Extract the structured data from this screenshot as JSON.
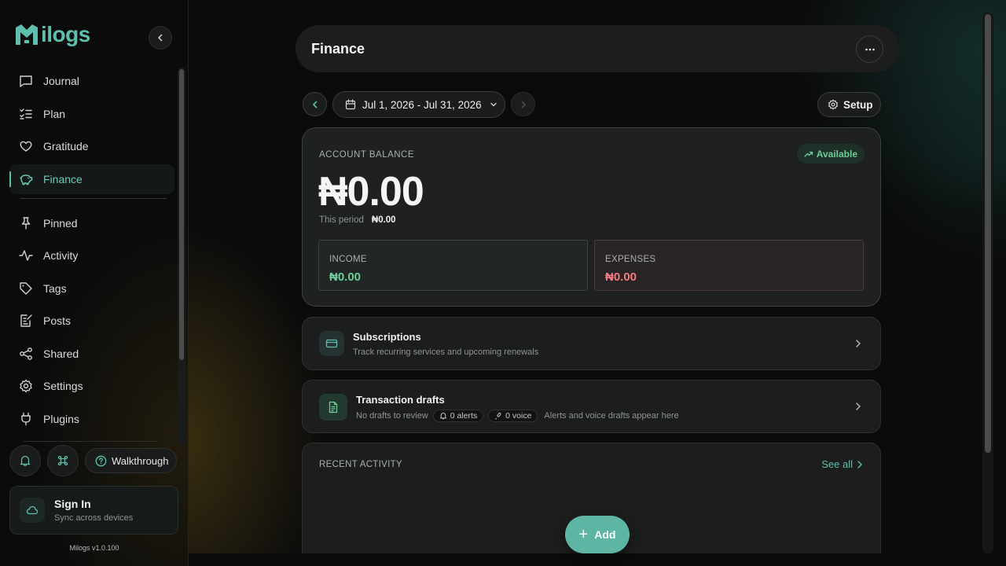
{
  "app": {
    "name": "Milogs",
    "version": "Milogs v1.0.100"
  },
  "colors": {
    "accent": "#5fbfae",
    "income": "#6fcf97",
    "expense": "#f07b84"
  },
  "sidebar": {
    "items": [
      {
        "label": "Journal",
        "icon": "chat-bubble-icon"
      },
      {
        "label": "Plan",
        "icon": "checklist-icon"
      },
      {
        "label": "Gratitude",
        "icon": "heart-icon"
      },
      {
        "label": "Finance",
        "icon": "piggy-bank-icon",
        "active": true
      }
    ],
    "items2": [
      {
        "label": "Pinned",
        "icon": "pin-icon"
      },
      {
        "label": "Activity",
        "icon": "pulse-icon"
      },
      {
        "label": "Tags",
        "icon": "tag-icon"
      },
      {
        "label": "Posts",
        "icon": "edit-doc-icon"
      },
      {
        "label": "Shared",
        "icon": "share-icon"
      },
      {
        "label": "Settings",
        "icon": "gear-icon"
      },
      {
        "label": "Plugins",
        "icon": "plug-icon"
      }
    ],
    "walkthrough": "Walkthrough",
    "signin": {
      "title": "Sign In",
      "subtitle": "Sync across devices"
    }
  },
  "header": {
    "title": "Finance"
  },
  "toolbar": {
    "date_range": "Jul 1, 2026 - Jul 31, 2026",
    "setup": "Setup"
  },
  "balance": {
    "label": "ACCOUNT BALANCE",
    "badge": "Available",
    "amount": "₦0.00",
    "period_label": "This period",
    "period_amount": "₦0.00",
    "income_label": "INCOME",
    "income_value": "₦0.00",
    "expenses_label": "EXPENSES",
    "expenses_value": "₦0.00"
  },
  "subscriptions": {
    "title": "Subscriptions",
    "subtitle": "Track recurring services and upcoming renewals"
  },
  "drafts": {
    "title": "Transaction drafts",
    "subtitle": "No drafts to review",
    "alerts": "0 alerts",
    "voice": "0 voice",
    "note": "Alerts and voice drafts appear here"
  },
  "recent": {
    "title": "RECENT ACTIVITY",
    "see_all": "See all"
  },
  "fab": {
    "label": "Add"
  }
}
